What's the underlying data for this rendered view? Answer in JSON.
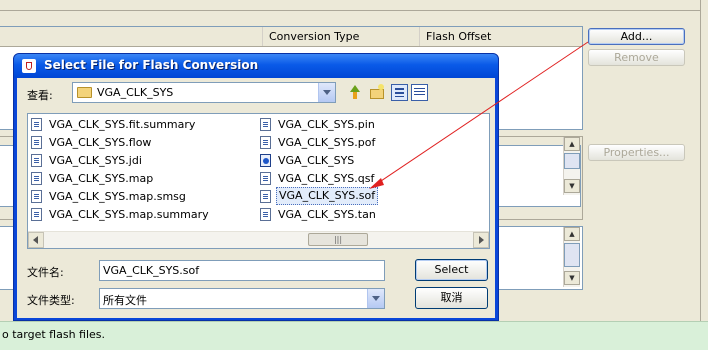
{
  "background": {
    "table_columns": [
      "Conversion Type",
      "Flash Offset"
    ],
    "buttons": {
      "add": "Add...",
      "remove": "Remove",
      "properties": "Properties..."
    },
    "status_text": "o target flash files."
  },
  "dialog": {
    "title": "Select File for Flash Conversion",
    "look_in_label": "查看:",
    "look_in_value": "VGA_CLK_SYS",
    "files": [
      {
        "name": "VGA_CLK_SYS.fit.summary",
        "icon": "file-icon"
      },
      {
        "name": "VGA_CLK_SYS.flow",
        "icon": "file-icon"
      },
      {
        "name": "VGA_CLK_SYS.jdi",
        "icon": "file-icon"
      },
      {
        "name": "VGA_CLK_SYS.map",
        "icon": "file-icon"
      },
      {
        "name": "VGA_CLK_SYS.map.smsg",
        "icon": "file-icon"
      },
      {
        "name": "VGA_CLK_SYS.map.summary",
        "icon": "file-icon"
      },
      {
        "name": "VGA_CLK_SYS.pin",
        "icon": "file-icon"
      },
      {
        "name": "VGA_CLK_SYS.pof",
        "icon": "file-icon"
      },
      {
        "name": "VGA_CLK_SYS",
        "icon": "project-icon"
      },
      {
        "name": "VGA_CLK_SYS.qsf",
        "icon": "file-icon"
      },
      {
        "name": "VGA_CLK_SYS.sof",
        "icon": "file-icon",
        "selected": true
      },
      {
        "name": "VGA_CLK_SYS.tan",
        "icon": "text-file-icon"
      }
    ],
    "file_name_label": "文件名:",
    "file_name_value": "VGA_CLK_SYS.sof",
    "file_type_label": "文件类型:",
    "file_type_value": "所有文件",
    "select_button": "Select",
    "cancel_button": "取消"
  },
  "colors": {
    "annotation_arrow": "#e02020",
    "title_bar": "#0a5ae8",
    "status_bar": "#d9f0d9"
  }
}
